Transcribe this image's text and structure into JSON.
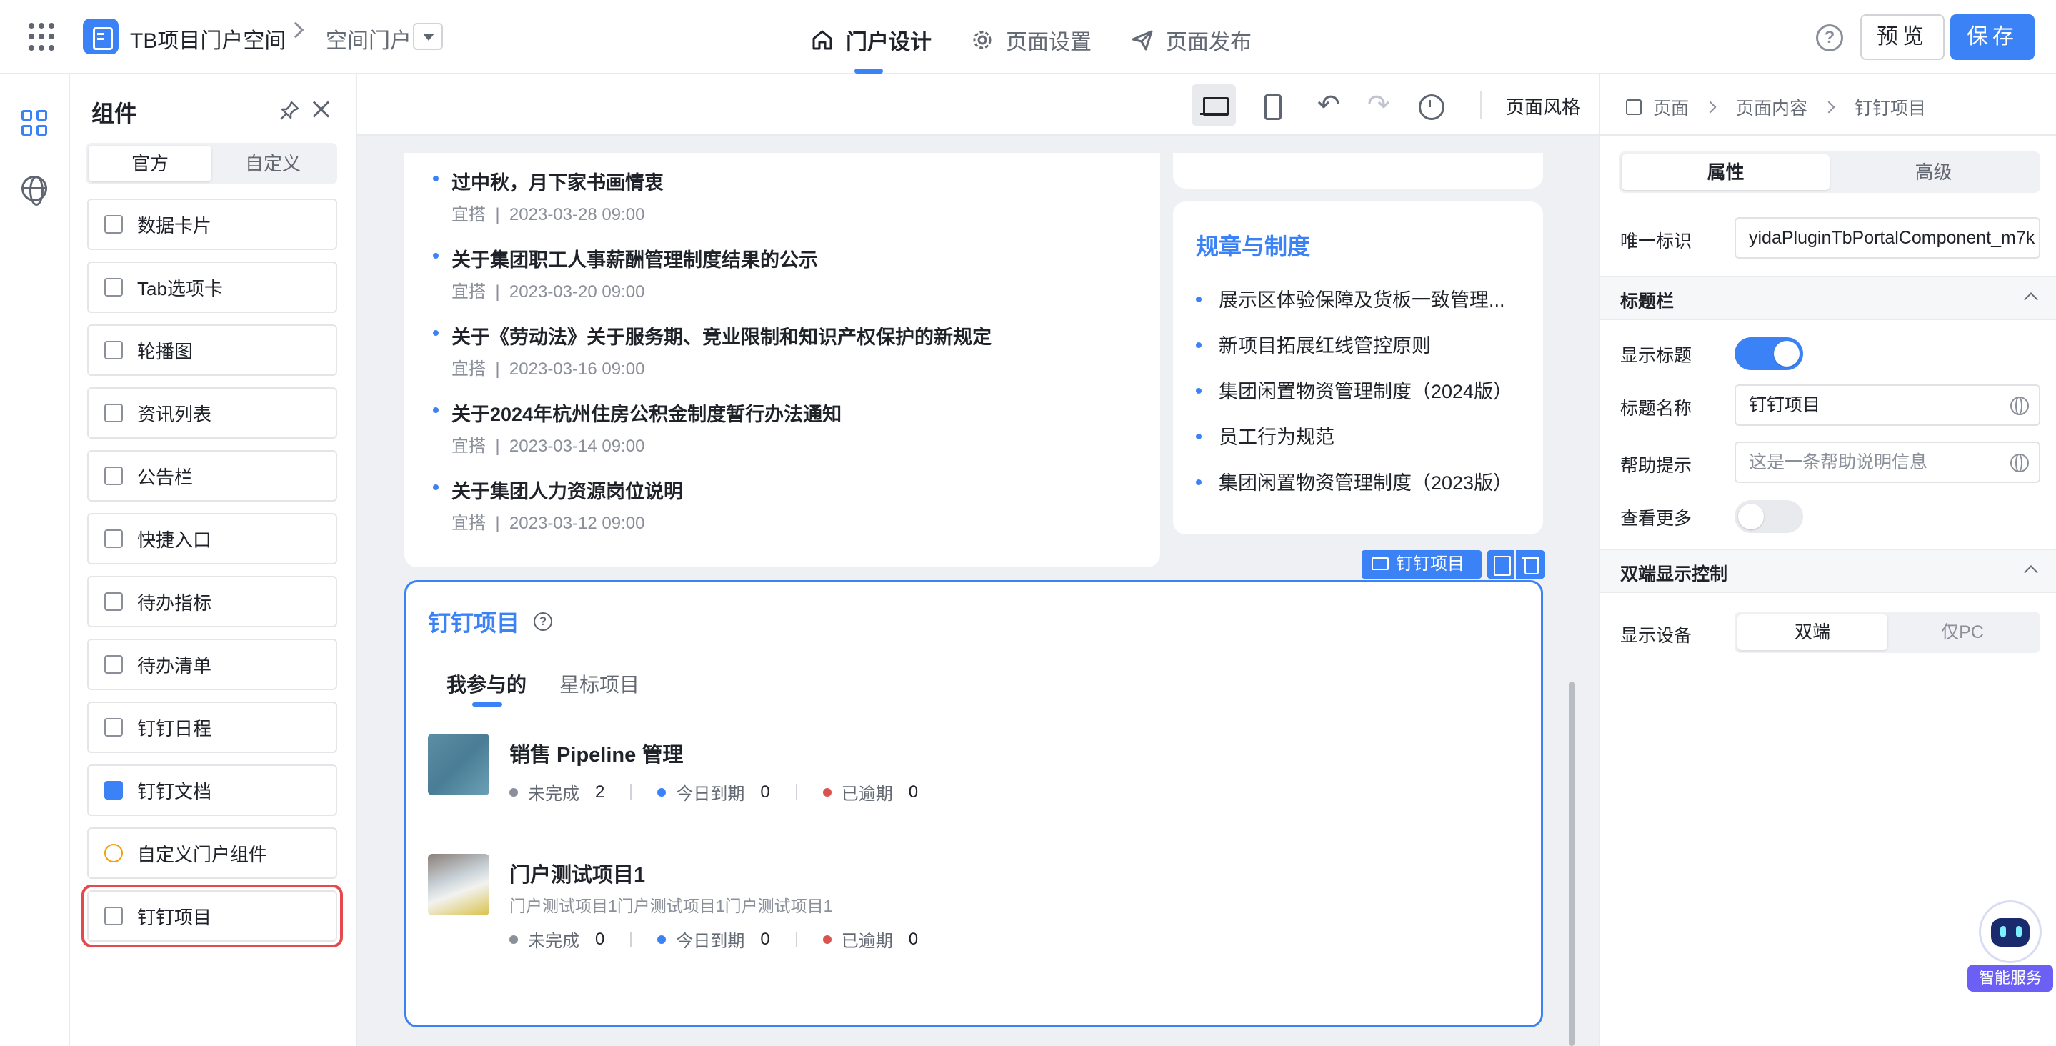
{
  "header": {
    "app_title": "TB项目门户空间",
    "space_portal": "空间门户",
    "tabs": [
      {
        "label": "门户设计",
        "icon": "home-icon",
        "active": true
      },
      {
        "label": "页面设置",
        "icon": "gear-icon",
        "active": false
      },
      {
        "label": "页面发布",
        "icon": "send-icon",
        "active": false
      }
    ],
    "help": "?",
    "preview": "预览",
    "save": "保存",
    "accent": "#3b82f6"
  },
  "components": {
    "title": "组件",
    "tabs": [
      "官方",
      "自定义"
    ],
    "items": [
      {
        "label": "数据卡片",
        "icon": "data-card-icon"
      },
      {
        "label": "Tab选项卡",
        "icon": "tab-icon"
      },
      {
        "label": "轮播图",
        "icon": "carousel-icon"
      },
      {
        "label": "资讯列表",
        "icon": "news-list-icon"
      },
      {
        "label": "公告栏",
        "icon": "megaphone-icon"
      },
      {
        "label": "快捷入口",
        "icon": "grid-icon"
      },
      {
        "label": "待办指标",
        "icon": "todo-metric-icon"
      },
      {
        "label": "待办清单",
        "icon": "todo-list-icon"
      },
      {
        "label": "钉钉日程",
        "icon": "calendar-icon"
      },
      {
        "label": "钉钉文档",
        "icon": "doc-icon"
      },
      {
        "label": "自定义门户组件",
        "icon": "puzzle-icon"
      },
      {
        "label": "钉钉项目",
        "icon": "project-icon",
        "highlighted": true
      }
    ]
  },
  "canvas": {
    "page_style": "页面风格",
    "news": [
      {
        "title": "过中秋，月下家书画情衷",
        "source": "宜搭",
        "date": "2023-03-28 09:00"
      },
      {
        "title": "关于集团职工人事薪酬管理制度结果的公示",
        "source": "宜搭",
        "date": "2023-03-20 09:00"
      },
      {
        "title": "关于《劳动法》关于服务期、竞业限制和知识产权保护的新规定",
        "source": "宜搭",
        "date": "2023-03-16 09:00"
      },
      {
        "title": "关于2024年杭州住房公积金制度暂行办法通知",
        "source": "宜搭",
        "date": "2023-03-14 09:00"
      },
      {
        "title": "关于集团人力资源岗位说明",
        "source": "宜搭",
        "date": "2023-03-12 09:00"
      }
    ],
    "meta_sep": "|",
    "rules": {
      "title": "规章与制度",
      "items": [
        "展示区体验保障及货板一致管理...",
        "新项目拓展红线管控原则",
        "集团闲置物资管理制度（2024版）",
        "员工行为规范",
        "集团闲置物资管理制度（2023版）"
      ]
    },
    "selection_tag": "钉钉项目",
    "ding_project": {
      "title": "钉钉项目",
      "help": "?",
      "tabs": [
        "我参与的",
        "星标项目"
      ],
      "projects": [
        {
          "name": "销售 Pipeline 管理",
          "desc": "",
          "stats": [
            {
              "label": "未完成",
              "value": "2",
              "color": "#8a8f99"
            },
            {
              "label": "今日到期",
              "value": "0",
              "color": "#3b82f6"
            },
            {
              "label": "已逾期",
              "value": "0",
              "color": "#d9534f"
            }
          ]
        },
        {
          "name": "门户测试项目1",
          "desc": "门户测试项目1门户测试项目1门户测试项目1",
          "stats": [
            {
              "label": "未完成",
              "value": "0",
              "color": "#8a8f99"
            },
            {
              "label": "今日到期",
              "value": "0",
              "color": "#3b82f6"
            },
            {
              "label": "已逾期",
              "value": "0",
              "color": "#d9534f"
            }
          ]
        }
      ]
    }
  },
  "properties": {
    "breadcrumb": [
      "页面",
      "页面内容",
      "钉钉项目"
    ],
    "tabs": [
      "属性",
      "高级"
    ],
    "unique_id_label": "唯一标识",
    "unique_id_value": "yidaPluginTbPortalComponent_m7k",
    "title_bar_section": "标题栏",
    "show_title_label": "显示标题",
    "show_title": true,
    "title_name_label": "标题名称",
    "title_name_value": "钉钉项目",
    "help_tip_label": "帮助提示",
    "help_tip_placeholder": "这是一条帮助说明信息",
    "view_more_label": "查看更多",
    "view_more": false,
    "dual_section": "双端显示控制",
    "device_label": "显示设备",
    "device_options": [
      "双端",
      "仅PC"
    ],
    "device_selected": "双端"
  },
  "assistant": {
    "label": "智能服务"
  }
}
